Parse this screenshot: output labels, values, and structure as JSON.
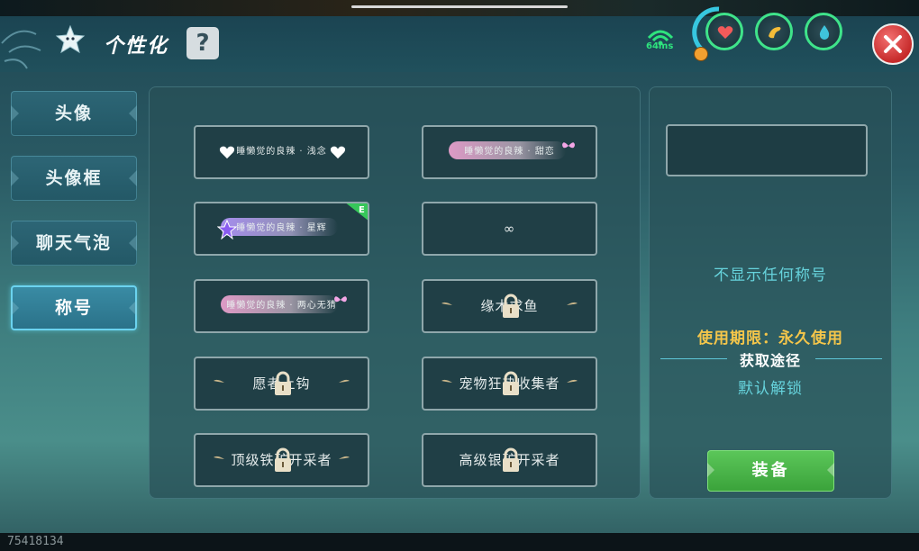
{
  "header": {
    "title": "个性化",
    "help_label": "?",
    "ping": "64ms",
    "icons": [
      "star-icon",
      "help-icon",
      "signal-icon",
      "heart-icon",
      "food-icon",
      "water-icon",
      "close-icon"
    ],
    "accent_color": "#3fe38a",
    "close_color": "#d63a3a"
  },
  "sidebar": {
    "items": [
      {
        "label": "头像",
        "active": false
      },
      {
        "label": "头像框",
        "active": false
      },
      {
        "label": "聊天气泡",
        "active": false
      },
      {
        "label": "称号",
        "active": true
      }
    ]
  },
  "titles": [
    {
      "label": "睡懒觉的良辣 · 浅念",
      "locked": false,
      "style": "hearts"
    },
    {
      "label": "睡懒觉的良辣 · 甜恋",
      "locked": false,
      "style": "pink-glow"
    },
    {
      "label": "睡懒觉的良辣 · 星辉",
      "locked": false,
      "style": "purple-glow",
      "badge": "E"
    },
    {
      "label": "∞",
      "locked": false,
      "style": "plain"
    },
    {
      "label": "睡懒觉的良辣 · 两心无猜",
      "locked": false,
      "style": "pink-glow"
    },
    {
      "label": "缘木求鱼",
      "locked": true,
      "style": "wings"
    },
    {
      "label": "愿者上钩",
      "locked": true,
      "style": "wings"
    },
    {
      "label": "宠物狂热收集者",
      "locked": true,
      "style": "wings"
    },
    {
      "label": "顶级铁矿开采者",
      "locked": true,
      "style": "wings"
    },
    {
      "label": "高级银矿开采者",
      "locked": true,
      "style": "wings"
    }
  ],
  "detail": {
    "no_title_text": "不显示任何称号",
    "period_text": "使用期限：永久使用",
    "obtain_label": "获取途径",
    "obtain_value": "默认解锁",
    "equip_label": "装备"
  },
  "footer": {
    "uid": "75418134"
  }
}
